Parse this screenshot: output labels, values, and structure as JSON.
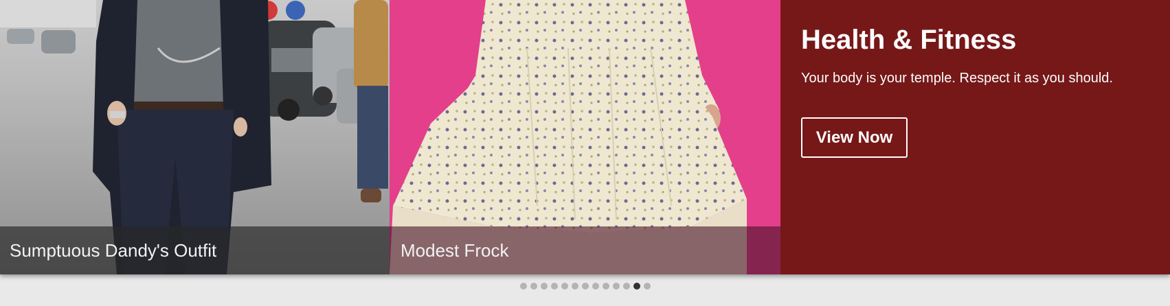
{
  "carousel": {
    "slides": [
      {
        "caption": "Sumptuous Dandy's Outfit"
      },
      {
        "caption": "Modest Frock"
      }
    ],
    "promo": {
      "title": "Health & Fitness",
      "subtitle": "Your body is your temple. Respect it as you should.",
      "button_label": "View Now",
      "background_color": "#761818"
    },
    "pagination": {
      "total": 13,
      "active_index": 11,
      "active_color": "#333333",
      "inactive_color": "#b4b4b4"
    }
  }
}
